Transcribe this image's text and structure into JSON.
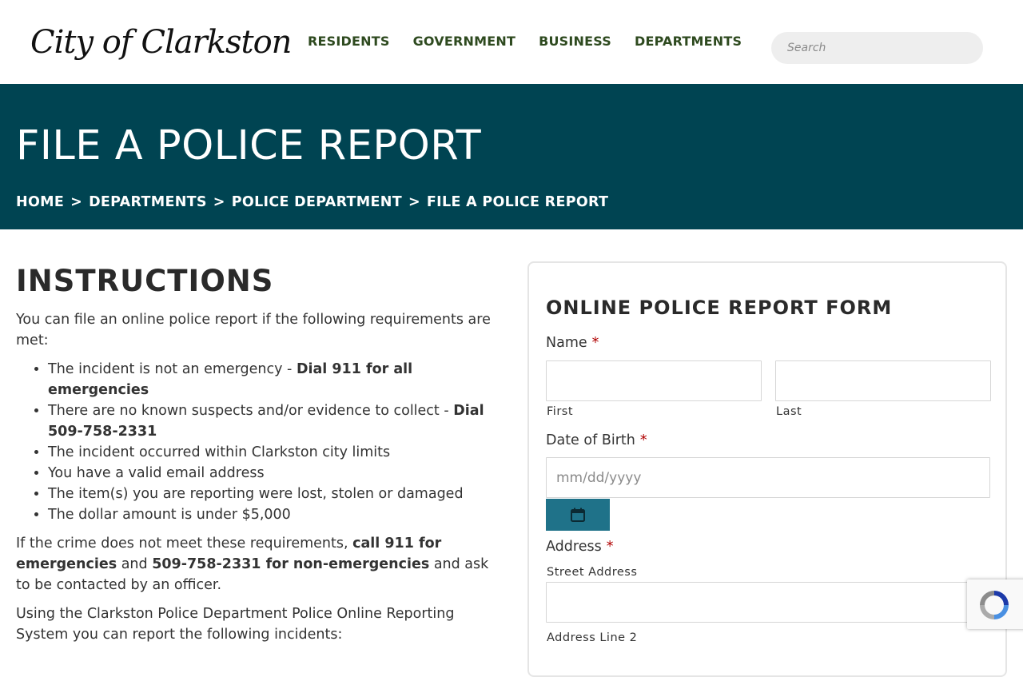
{
  "header": {
    "logo_text": "City of Clarkston",
    "nav": [
      "RESIDENTS",
      "GOVERNMENT",
      "BUSINESS",
      "DEPARTMENTS"
    ],
    "search_placeholder": "Search"
  },
  "banner": {
    "title": "FILE A POLICE REPORT",
    "breadcrumb": [
      "HOME",
      "DEPARTMENTS",
      "POLICE DEPARTMENT",
      "FILE A POLICE REPORT"
    ],
    "separator": ">"
  },
  "instructions": {
    "heading": "INSTRUCTIONS",
    "intro": "You can file an online police report if the following requirements are met:",
    "items": [
      {
        "text": "The incident is not an emergency - ",
        "bold": "Dial 911 for all emergencies"
      },
      {
        "text": "There are no known suspects and/or evidence to collect - ",
        "bold": "Dial 509-758-2331"
      },
      {
        "text": "The incident occurred within Clarkston city limits",
        "bold": ""
      },
      {
        "text": "You have a valid email address",
        "bold": ""
      },
      {
        "text": "The item(s) you are reporting were lost, stolen or damaged",
        "bold": ""
      },
      {
        "text": "The dollar amount is under $5,000",
        "bold": ""
      }
    ],
    "para2": {
      "t1": "If the crime does not meet these requirements, ",
      "b1": "call 911 for emergencies",
      "t2": " and ",
      "b2": "509-758-2331 for non-emergencies",
      "t3": " and ask to be contacted by an officer."
    },
    "para3": "Using the Clarkston Police Department Police Online Reporting System you can report the following incidents:"
  },
  "form": {
    "title": "ONLINE POLICE REPORT FORM",
    "name_label": "Name",
    "required_mark": "*",
    "first_label": "First",
    "last_label": "Last",
    "first_value": "",
    "last_value": "",
    "dob_label": "Date of Birth",
    "dob_placeholder": "mm/dd/yyyy",
    "calendar_icon": "calendar-icon",
    "address_label": "Address",
    "street_label": "Street Address",
    "street_value": "",
    "address2_label": "Address Line 2"
  },
  "colors": {
    "nav_text": "#2e4a1f",
    "banner_bg": "#004452",
    "calendar_button": "#1f7289",
    "required": "#b00000"
  }
}
